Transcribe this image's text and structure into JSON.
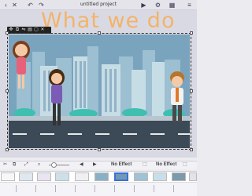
{
  "window": {
    "title": "untitled project"
  },
  "topbar_icons": [
    "back-icon",
    "close-icon",
    "undo-icon",
    "redo-icon",
    "preview-icon",
    "settings-icon",
    "grid-icon",
    "menu-icon"
  ],
  "canvas": {
    "headline": "What we do"
  },
  "effects": {
    "left": "No Effect",
    "right": "No Effect"
  },
  "colors": {
    "sky": "#6f98b4",
    "headline": "#f3b36b",
    "road": "#3c4a57",
    "accent_teal": "#3fbfb0"
  }
}
